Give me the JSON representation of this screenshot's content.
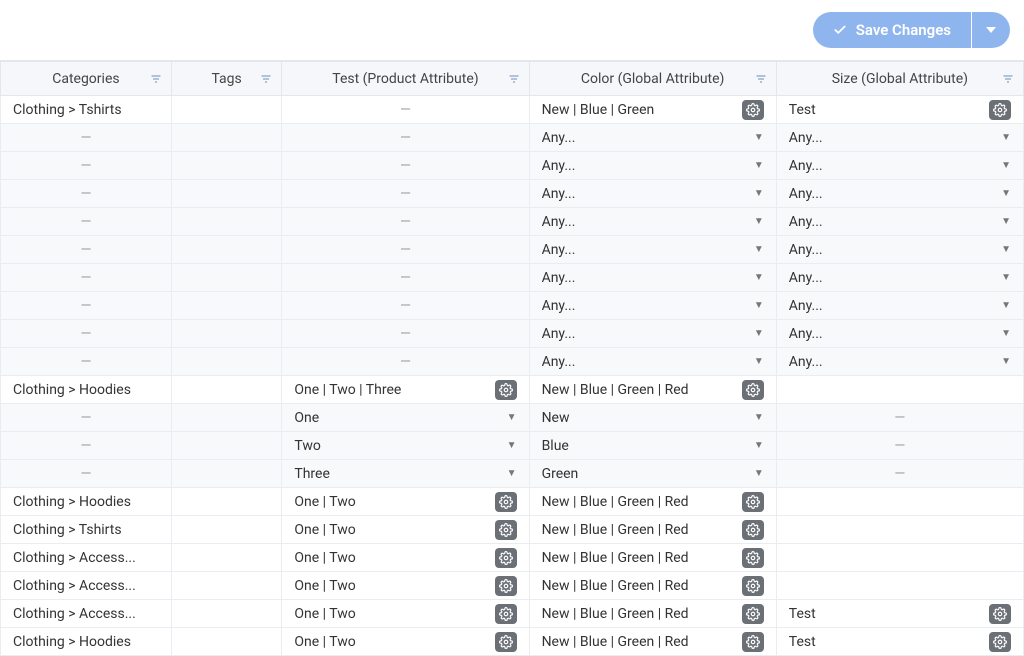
{
  "toolbar": {
    "save_label": "Save Changes"
  },
  "columns": [
    {
      "label": "Categories"
    },
    {
      "label": "Tags"
    },
    {
      "label": "Test (Product Attribute)"
    },
    {
      "label": "Color (Global Attribute)"
    },
    {
      "label": "Size (Global Attribute)"
    }
  ],
  "placeholders": {
    "any": "Any...",
    "dash": "—"
  },
  "rows": [
    {
      "alt": false,
      "categories": "Clothing > Tshirts",
      "tags": "",
      "test": {
        "dash": true
      },
      "color": {
        "text": "New | Blue | Green",
        "gear": true
      },
      "size": {
        "text": "Test",
        "gear": true
      }
    },
    {
      "alt": true,
      "categories": "—",
      "tags": "",
      "test": {
        "dash": true
      },
      "color": {
        "text": "Any...",
        "dropdown": true
      },
      "size": {
        "text": "Any...",
        "dropdown": true
      }
    },
    {
      "alt": true,
      "categories": "—",
      "tags": "",
      "test": {
        "dash": true
      },
      "color": {
        "text": "Any...",
        "dropdown": true
      },
      "size": {
        "text": "Any...",
        "dropdown": true
      }
    },
    {
      "alt": true,
      "categories": "—",
      "tags": "",
      "test": {
        "dash": true
      },
      "color": {
        "text": "Any...",
        "dropdown": true
      },
      "size": {
        "text": "Any...",
        "dropdown": true
      }
    },
    {
      "alt": true,
      "categories": "—",
      "tags": "",
      "test": {
        "dash": true
      },
      "color": {
        "text": "Any...",
        "dropdown": true
      },
      "size": {
        "text": "Any...",
        "dropdown": true
      }
    },
    {
      "alt": true,
      "categories": "—",
      "tags": "",
      "test": {
        "dash": true
      },
      "color": {
        "text": "Any...",
        "dropdown": true
      },
      "size": {
        "text": "Any...",
        "dropdown": true
      }
    },
    {
      "alt": true,
      "categories": "—",
      "tags": "",
      "test": {
        "dash": true
      },
      "color": {
        "text": "Any...",
        "dropdown": true
      },
      "size": {
        "text": "Any...",
        "dropdown": true
      }
    },
    {
      "alt": true,
      "categories": "—",
      "tags": "",
      "test": {
        "dash": true
      },
      "color": {
        "text": "Any...",
        "dropdown": true
      },
      "size": {
        "text": "Any...",
        "dropdown": true
      }
    },
    {
      "alt": true,
      "categories": "—",
      "tags": "",
      "test": {
        "dash": true
      },
      "color": {
        "text": "Any...",
        "dropdown": true
      },
      "size": {
        "text": "Any...",
        "dropdown": true
      }
    },
    {
      "alt": true,
      "categories": "—",
      "tags": "",
      "test": {
        "dash": true
      },
      "color": {
        "text": "Any...",
        "dropdown": true
      },
      "size": {
        "text": "Any...",
        "dropdown": true
      }
    },
    {
      "alt": false,
      "categories": "Clothing > Hoodies",
      "tags": "",
      "test": {
        "text": "One | Two | Three",
        "gear": true
      },
      "color": {
        "text": "New | Blue | Green | Red",
        "gear": true
      },
      "size": {
        "text": ""
      }
    },
    {
      "alt": true,
      "categories": "—",
      "tags": "",
      "test": {
        "text": "One",
        "dropdown": true
      },
      "color": {
        "text": "New",
        "dropdown": true
      },
      "size": {
        "dash": true
      }
    },
    {
      "alt": true,
      "categories": "—",
      "tags": "",
      "test": {
        "text": "Two",
        "dropdown": true
      },
      "color": {
        "text": "Blue",
        "dropdown": true
      },
      "size": {
        "dash": true
      }
    },
    {
      "alt": true,
      "categories": "—",
      "tags": "",
      "test": {
        "text": "Three",
        "dropdown": true
      },
      "color": {
        "text": "Green",
        "dropdown": true
      },
      "size": {
        "dash": true
      }
    },
    {
      "alt": false,
      "categories": "Clothing > Hoodies",
      "tags": "",
      "test": {
        "text": "One | Two",
        "gear": true
      },
      "color": {
        "text": "New | Blue | Green | Red",
        "gear": true
      },
      "size": {
        "text": ""
      }
    },
    {
      "alt": false,
      "categories": "Clothing > Tshirts",
      "tags": "",
      "test": {
        "text": "One | Two",
        "gear": true
      },
      "color": {
        "text": "New | Blue | Green | Red",
        "gear": true
      },
      "size": {
        "text": ""
      }
    },
    {
      "alt": false,
      "categories": "Clothing > Access...",
      "tags": "",
      "test": {
        "text": "One | Two",
        "gear": true
      },
      "color": {
        "text": "New | Blue | Green | Red",
        "gear": true
      },
      "size": {
        "text": ""
      }
    },
    {
      "alt": false,
      "categories": "Clothing > Access...",
      "tags": "",
      "test": {
        "text": "One | Two",
        "gear": true
      },
      "color": {
        "text": "New | Blue | Green | Red",
        "gear": true
      },
      "size": {
        "text": ""
      }
    },
    {
      "alt": false,
      "categories": "Clothing > Access...",
      "tags": "",
      "test": {
        "text": "One | Two",
        "gear": true
      },
      "color": {
        "text": "New | Blue | Green | Red",
        "gear": true
      },
      "size": {
        "text": "Test",
        "gear": true
      }
    },
    {
      "alt": false,
      "categories": "Clothing > Hoodies",
      "tags": "",
      "test": {
        "text": "One | Two",
        "gear": true
      },
      "color": {
        "text": "New | Blue | Green | Red",
        "gear": true
      },
      "size": {
        "text": "Test",
        "gear": true
      }
    }
  ]
}
